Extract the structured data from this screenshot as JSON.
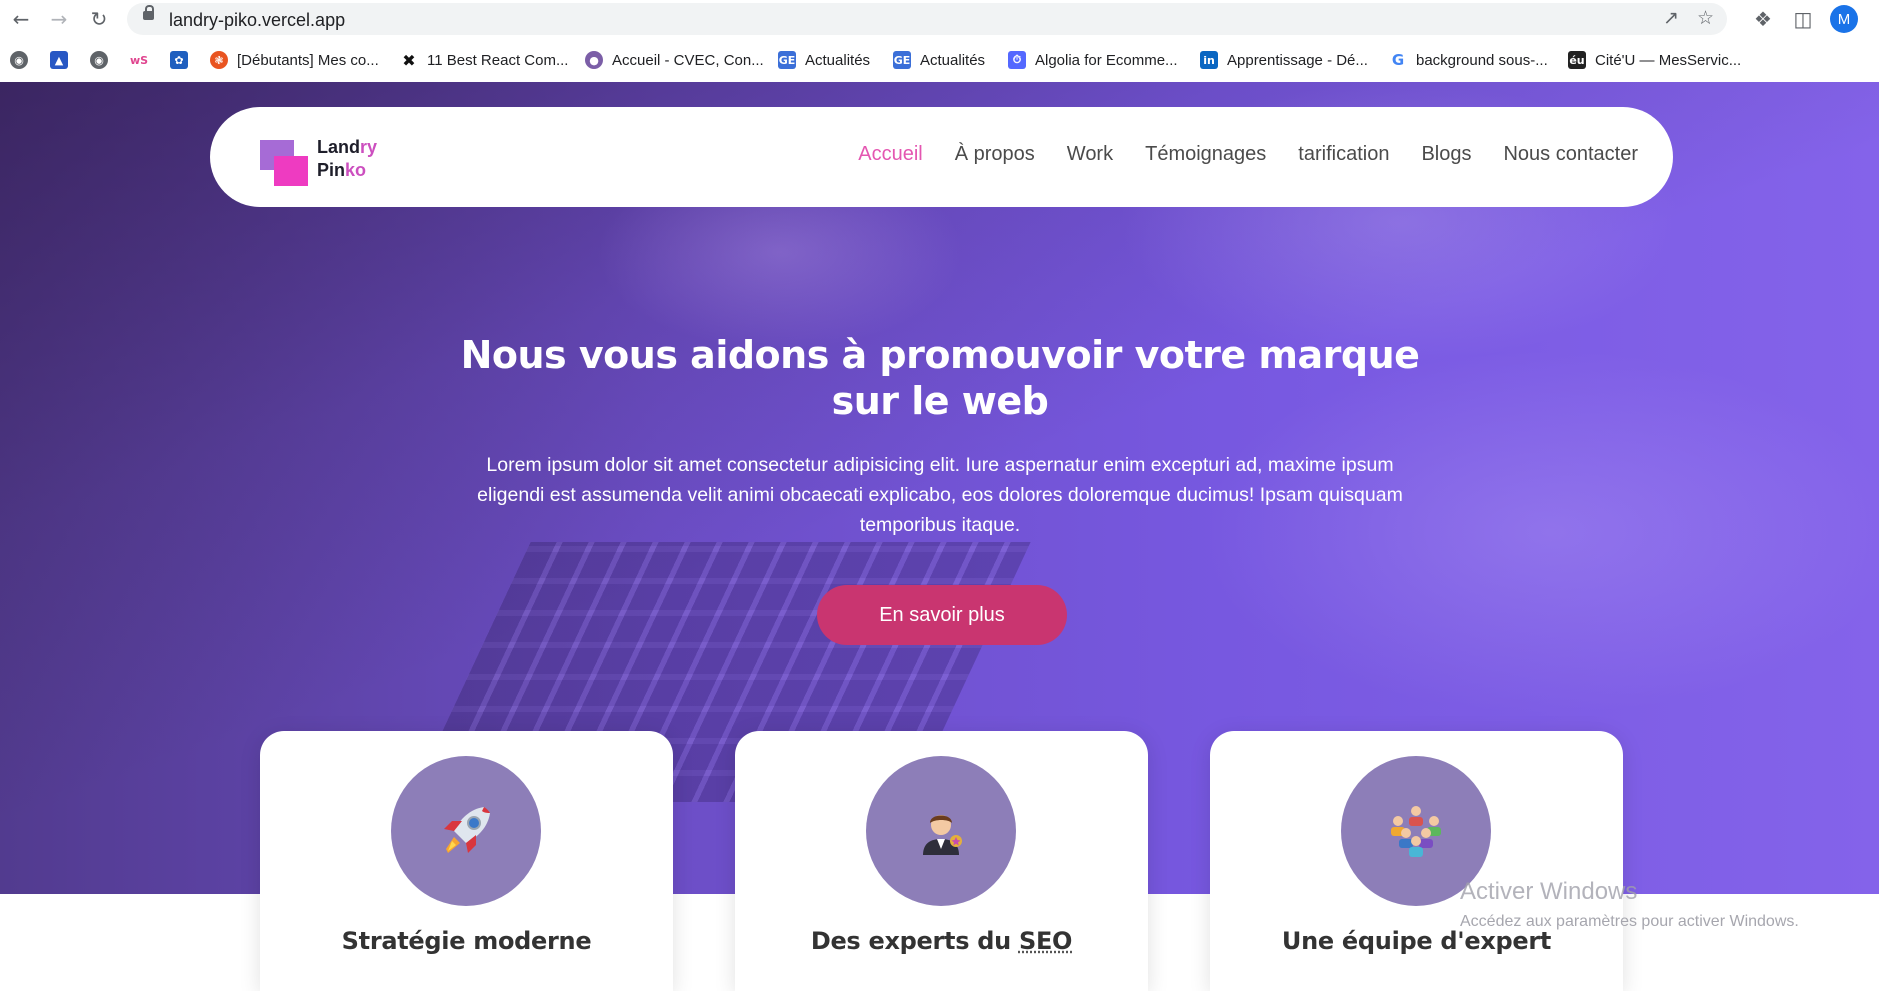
{
  "browser": {
    "url": "landry-piko.vercel.app",
    "profile_initial": "M",
    "bookmarks": [
      {
        "label": "[Débutants] Mes co...",
        "icon": "ubuntu-icon",
        "color": "#e95420"
      },
      {
        "label": "11 Best React Com...",
        "icon": "x-icon",
        "color": "#111111"
      },
      {
        "label": "Accueil - CVEC, Con...",
        "icon": "cvec-icon",
        "color": "#7b5ea7"
      },
      {
        "label": "Actualités",
        "icon": "ge-icon",
        "color": "#3b6fd8"
      },
      {
        "label": "Actualités",
        "icon": "ge-icon",
        "color": "#3b6fd8"
      },
      {
        "label": "Algolia for Ecomme...",
        "icon": "algolia-icon",
        "color": "#5468ff"
      },
      {
        "label": "Apprentissage - Dé...",
        "icon": "linkedin-icon",
        "color": "#0a66c2"
      },
      {
        "label": "background sous-...",
        "icon": "google-icon",
        "color": "#4285f4"
      },
      {
        "label": "Cité'U — MesServic...",
        "icon": "cite-u-icon",
        "color": "#222222"
      }
    ]
  },
  "nav": {
    "logo_top_a": "Land",
    "logo_top_b": "ry",
    "logo_bottom_a": "Pin",
    "logo_bottom_b": "ko",
    "links": [
      "Accueil",
      "À propos",
      "Work",
      "Témoignages",
      "tarification",
      "Blogs",
      "Nous contacter"
    ]
  },
  "hero": {
    "title_line1": "Nous vous aidons à promouvoir votre marque",
    "title_line2": "sur le web",
    "text": "Lorem ipsum dolor sit amet consectetur adipisicing elit. Iure aspernatur enim excepturi ad, maxime ipsum eligendi est assumenda velit animi obcaecati explicabo, eos dolores doloremque ducimus! Ipsam quisquam temporibus itaque.",
    "cta": "En savoir plus"
  },
  "cards": [
    {
      "title": "Stratégie moderne",
      "icon": "rocket-icon"
    },
    {
      "title_a": "Des experts du ",
      "title_b": "SEO",
      "icon": "expert-icon"
    },
    {
      "title": "Une équipe d'expert",
      "icon": "team-icon"
    }
  ],
  "watermark": {
    "title": "Activer Windows",
    "subtitle": "Accédez aux paramètres pour activer Windows."
  },
  "colors": {
    "accent_pink": "#e456b1",
    "cta": "#c93570",
    "hero_purple": "#7758e0",
    "card_circle": "#8d7eb8"
  }
}
